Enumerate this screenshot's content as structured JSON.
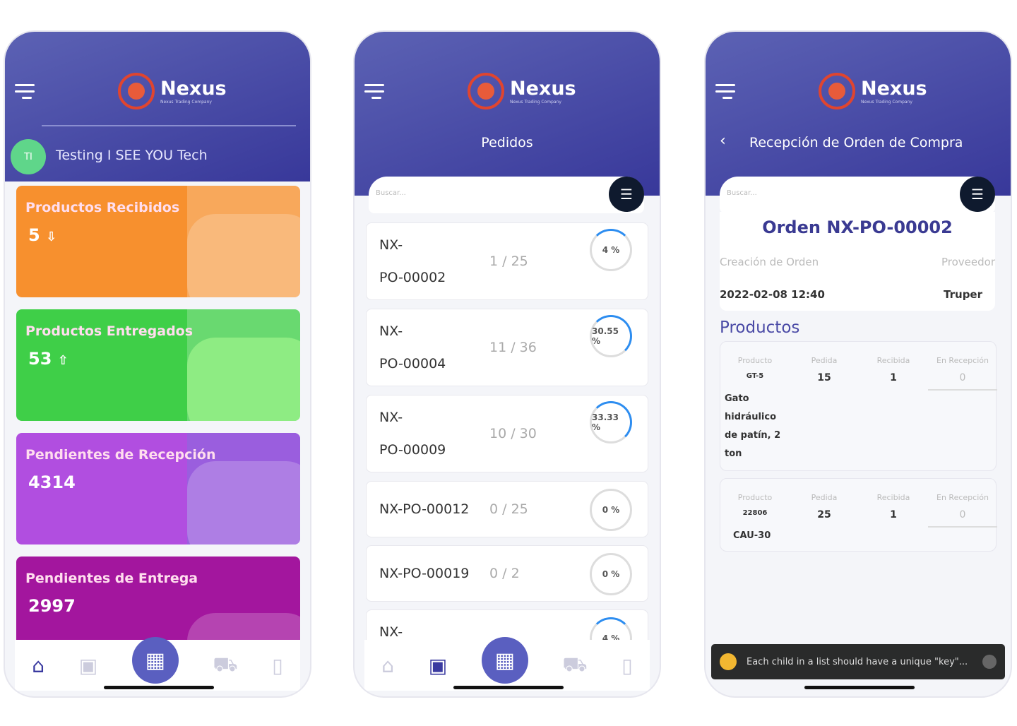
{
  "brand": {
    "name": "Nexus",
    "tagline": "Nexus Trading Company",
    "accent": "#3f40a0"
  },
  "screen1": {
    "user_initials": "TI",
    "user_name": "Testing I SEE YOU Tech",
    "cards": [
      {
        "title": "Productos Recibidos",
        "value": "5",
        "icon": "arrow-down-icon",
        "color": "#f7902e"
      },
      {
        "title": "Productos Entregados",
        "value": "53",
        "icon": "arrow-up-icon",
        "color": "#3fcf48"
      },
      {
        "title": "Pendientes de Recepción",
        "value": "4314",
        "color": "#b14ee0"
      },
      {
        "title": "Pendientes de Entrega",
        "value": "2997",
        "color": "#a3169e"
      }
    ]
  },
  "screen2": {
    "title": "Pedidos",
    "search_placeholder": "Buscar...",
    "orders": [
      {
        "code1": "NX-",
        "code2": "PO-00002",
        "qty": "1 / 25",
        "pct": "4 %",
        "progress": 4
      },
      {
        "code1": "NX-",
        "code2": "PO-00004",
        "qty": "11 / 36",
        "pct": "30.55 %",
        "progress": 30.55
      },
      {
        "code1": "NX-",
        "code2": "PO-00009",
        "qty": "10 / 30",
        "pct": "33.33 %",
        "progress": 33.33
      },
      {
        "code1": "NX-PO-00012",
        "code2": "",
        "qty": "0 / 25",
        "pct": "0 %",
        "progress": 0
      },
      {
        "code1": "NX-PO-00019",
        "code2": "",
        "qty": "0 / 2",
        "pct": "0 %",
        "progress": 0
      },
      {
        "code1": "NX-",
        "code2": "",
        "qty": "",
        "pct": "4 %",
        "progress": 4
      }
    ]
  },
  "screen3": {
    "title": "Recepción de Orden de Compra",
    "search_placeholder": "Buscar...",
    "order_title": "Orden NX-PO-00002",
    "created_label": "Creación de Orden",
    "created_value": "2022-02-08 12:40",
    "supplier_label": "Proveedor",
    "supplier_value": "Truper",
    "products_heading": "Productos",
    "columns": [
      "Producto",
      "Pedida",
      "Recibida",
      "En Recepción"
    ],
    "products": [
      {
        "sku": "GT-5",
        "name": "Gato hidráulico de patín, 2 ton",
        "ordered": "15",
        "received": "1",
        "receiving": "0"
      },
      {
        "sku": "22806",
        "name": "CAU-30",
        "ordered": "25",
        "received": "1",
        "receiving": "0"
      }
    ],
    "toast": "Each child in a list should have a unique \"key\"..."
  }
}
